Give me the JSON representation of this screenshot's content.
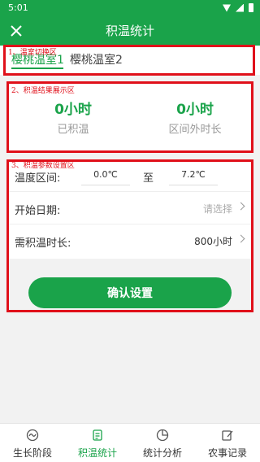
{
  "status": {
    "time": "5:01"
  },
  "appbar": {
    "title": "积温统计"
  },
  "tabs": [
    {
      "label": "樱桃温室1",
      "active": true
    },
    {
      "label": "樱桃温室2",
      "active": false
    }
  ],
  "annotations": {
    "tabs": "1、温室切换区",
    "results": "2、积温结果展示区",
    "params": "3、积温参数设置区"
  },
  "results": {
    "accumulated": {
      "value": "0小时",
      "label": "已积温"
    },
    "outside": {
      "value": "0小时",
      "label": "区间外时长"
    }
  },
  "params": {
    "temp_range_label": "温度区间:",
    "temp_min": "0.0℃",
    "temp_to": "至",
    "temp_max": "7.2℃",
    "start_date_label": "开始日期:",
    "start_date_placeholder": "请选择",
    "needed_label": "需积温时长:",
    "needed_value": "800小时"
  },
  "confirm": {
    "label": "确认设置"
  },
  "bottom_nav": [
    {
      "label": "生长阶段",
      "icon": "growth-stage-icon",
      "active": false
    },
    {
      "label": "积温统计",
      "icon": "accumulated-temp-icon",
      "active": true
    },
    {
      "label": "统计分析",
      "icon": "pie-chart-icon",
      "active": false
    },
    {
      "label": "农事记录",
      "icon": "edit-record-icon",
      "active": false
    }
  ],
  "colors": {
    "brand": "#1aa34a",
    "annotation": "#e0101a"
  }
}
